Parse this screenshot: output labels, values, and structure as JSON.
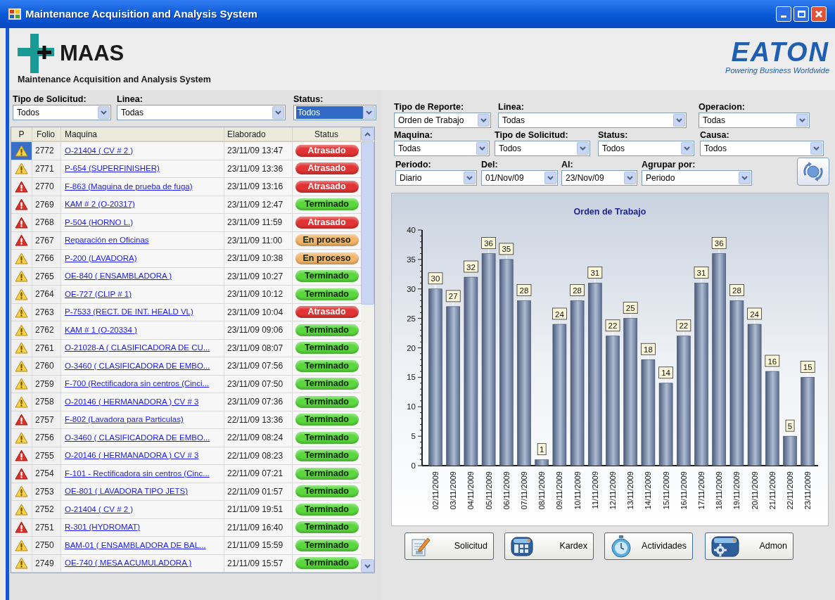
{
  "window": {
    "title": "Maintenance Acquisition and Analysis System"
  },
  "header": {
    "logo_text": "MAAS",
    "subtitle": "Maintenance Acquisition and Analysis System",
    "brand": "EATON",
    "tagline": "Powering Business Worldwide"
  },
  "list_filters": [
    {
      "label": "Tipo de Solicitud:",
      "value": "Todos",
      "focused": false
    },
    {
      "label": "Linea:",
      "value": "Todas",
      "focused": false
    },
    {
      "label": "Status:",
      "value": "Todos",
      "focused": true
    }
  ],
  "table": {
    "columns": [
      "P",
      "Folio",
      "Maquina",
      "Elaborado",
      "Status"
    ],
    "rows": [
      {
        "selected": true,
        "kind": "warning",
        "folio": "2772",
        "machine": "O-21404 ( CV # 2 )",
        "elaborado": "23/11/09 13:47",
        "status": {
          "text": "Atrasado",
          "color": "#e23434"
        }
      },
      {
        "selected": false,
        "kind": "warning",
        "folio": "2771",
        "machine": "P-654 (SUPERFINISHER)",
        "elaborado": "23/11/09 13:36",
        "status": {
          "text": "Atrasado",
          "color": "#e23434"
        }
      },
      {
        "selected": false,
        "kind": "critical",
        "folio": "2770",
        "machine": "F-863 (Maquina de prueba de fuga)",
        "elaborado": "23/11/09 13:16",
        "status": {
          "text": "Atrasado",
          "color": "#e23434"
        }
      },
      {
        "selected": false,
        "kind": "critical",
        "folio": "2769",
        "machine": "KAM # 2 (O-20317)",
        "elaborado": "23/11/09 12:47",
        "status": {
          "text": "Terminado",
          "color": "#5ad83e"
        }
      },
      {
        "selected": false,
        "kind": "critical",
        "folio": "2768",
        "machine": "P-504 (HORNO L.)",
        "elaborado": "23/11/09 11:59",
        "status": {
          "text": "Atrasado",
          "color": "#e23434"
        }
      },
      {
        "selected": false,
        "kind": "critical",
        "folio": "2767",
        "machine": "Reparación en Oficinas",
        "elaborado": "23/11/09 11:00",
        "status": {
          "text": "En proceso",
          "color": "#f3b56a"
        }
      },
      {
        "selected": false,
        "kind": "warning",
        "folio": "2766",
        "machine": "P-200 (LAVADORA)",
        "elaborado": "23/11/09 10:38",
        "status": {
          "text": "En proceso",
          "color": "#f3b56a"
        }
      },
      {
        "selected": false,
        "kind": "warning",
        "folio": "2765",
        "machine": "OE-840 ( ENSAMBLADORA )",
        "elaborado": "23/11/09 10:27",
        "status": {
          "text": "Terminado",
          "color": "#5ad83e"
        }
      },
      {
        "selected": false,
        "kind": "warning",
        "folio": "2764",
        "machine": "OE-727 (CLIP # 1)",
        "elaborado": "23/11/09 10:12",
        "status": {
          "text": "Terminado",
          "color": "#5ad83e"
        }
      },
      {
        "selected": false,
        "kind": "warning",
        "folio": "2763",
        "machine": "P-7533 (RECT. DE INT. HEALD VL)",
        "elaborado": "23/11/09 10:04",
        "status": {
          "text": "Atrasado",
          "color": "#e23434"
        }
      },
      {
        "selected": false,
        "kind": "warning",
        "folio": "2762",
        "machine": "KAM # 1 (O-20334 )",
        "elaborado": "23/11/09 09:06",
        "status": {
          "text": "Terminado",
          "color": "#5ad83e"
        }
      },
      {
        "selected": false,
        "kind": "warning",
        "folio": "2761",
        "machine": "O-21028-A ( CLASIFICADORA DE CU...",
        "elaborado": "23/11/09 08:07",
        "status": {
          "text": "Terminado",
          "color": "#5ad83e"
        }
      },
      {
        "selected": false,
        "kind": "warning",
        "folio": "2760",
        "machine": "O-3460 ( CLASIFICADORA DE EMBO...",
        "elaborado": "23/11/09 07:56",
        "status": {
          "text": "Terminado",
          "color": "#5ad83e"
        }
      },
      {
        "selected": false,
        "kind": "warning",
        "folio": "2759",
        "machine": "F-700 (Rectificadora sin centros (Cinci...",
        "elaborado": "23/11/09 07:50",
        "status": {
          "text": "Terminado",
          "color": "#5ad83e"
        }
      },
      {
        "selected": false,
        "kind": "warning",
        "folio": "2758",
        "machine": "O-20146 ( HERMANADORA ) CV # 3",
        "elaborado": "23/11/09 07:36",
        "status": {
          "text": "Terminado",
          "color": "#5ad83e"
        }
      },
      {
        "selected": false,
        "kind": "critical",
        "folio": "2757",
        "machine": "F-802 (Lavadora para Particulas)",
        "elaborado": "22/11/09 13:36",
        "status": {
          "text": "Terminado",
          "color": "#5ad83e"
        }
      },
      {
        "selected": false,
        "kind": "warning",
        "folio": "2756",
        "machine": "O-3460 ( CLASIFICADORA DE EMBO...",
        "elaborado": "22/11/09 08:24",
        "status": {
          "text": "Terminado",
          "color": "#5ad83e"
        }
      },
      {
        "selected": false,
        "kind": "critical",
        "folio": "2755",
        "machine": "O-20146 ( HERMANADORA ) CV # 3",
        "elaborado": "22/11/09 08:23",
        "status": {
          "text": "Terminado",
          "color": "#5ad83e"
        }
      },
      {
        "selected": false,
        "kind": "critical",
        "folio": "2754",
        "machine": "F-101 - Rectificadora sin centros (Cinc...",
        "elaborado": "22/11/09 07:21",
        "status": {
          "text": "Terminado",
          "color": "#5ad83e"
        }
      },
      {
        "selected": false,
        "kind": "warning",
        "folio": "2753",
        "machine": "OE-801 ( LAVADORA TIPO JETS)",
        "elaborado": "22/11/09 01:57",
        "status": {
          "text": "Terminado",
          "color": "#5ad83e"
        }
      },
      {
        "selected": false,
        "kind": "warning",
        "folio": "2752",
        "machine": "O-21404 ( CV # 2 )",
        "elaborado": "21/11/09 19:51",
        "status": {
          "text": "Terminado",
          "color": "#5ad83e"
        }
      },
      {
        "selected": false,
        "kind": "critical",
        "folio": "2751",
        "machine": "R-301 (HYDROMAT)",
        "elaborado": "21/11/09 16:40",
        "status": {
          "text": "Terminado",
          "color": "#5ad83e"
        }
      },
      {
        "selected": false,
        "kind": "warning",
        "folio": "2750",
        "machine": "BAM-01 ( ENSAMBLADORA DE BAL...",
        "elaborado": "21/11/09 15:59",
        "status": {
          "text": "Terminado",
          "color": "#5ad83e"
        }
      },
      {
        "selected": false,
        "kind": "warning",
        "folio": "2749",
        "machine": "OE-740 ( MESA ACUMULADORA )",
        "elaborado": "21/11/09 15:57",
        "status": {
          "text": "Terminado",
          "color": "#5ad83e"
        }
      }
    ]
  },
  "report_filters": [
    [
      {
        "label": "Tipo de Reporte:",
        "value": "Orden de Trabajo"
      },
      {
        "label": "Linea:",
        "value": "Todas"
      },
      {
        "label": "Operacion:",
        "value": "Todas"
      }
    ],
    [
      {
        "label": "Maquina:",
        "value": "Todas"
      },
      {
        "label": "Tipo de Solicitud:",
        "value": "Todos"
      },
      {
        "label": "Status:",
        "value": "Todos"
      },
      {
        "label": "Causa:",
        "value": "Todos"
      }
    ],
    [
      {
        "label": "Periodo:",
        "value": "Diario"
      },
      {
        "label": "Del:",
        "value": "01/Nov/09"
      },
      {
        "label": "Al:",
        "value": "23/Nov/09"
      },
      {
        "label": "Agrupar por:",
        "value": "Periodo"
      }
    ]
  ],
  "chart_data": {
    "type": "bar",
    "title": "Orden de Trabajo",
    "categories": [
      "02/11/2009",
      "03/11/2009",
      "04/11/2009",
      "05/11/2009",
      "06/11/2009",
      "07/11/2009",
      "08/11/2009",
      "09/11/2009",
      "10/11/2009",
      "11/11/2009",
      "12/11/2009",
      "13/11/2009",
      "14/11/2009",
      "15/11/2009",
      "16/11/2009",
      "17/11/2009",
      "18/11/2009",
      "19/11/2009",
      "20/11/2009",
      "21/11/2009",
      "22/11/2009",
      "23/11/2009"
    ],
    "values": [
      30,
      27,
      32,
      36,
      35,
      28,
      1,
      24,
      28,
      31,
      22,
      25,
      18,
      14,
      22,
      31,
      36,
      28,
      24,
      16,
      5,
      15
    ],
    "ylim": [
      0,
      40
    ],
    "yticks": [
      0,
      5,
      10,
      15,
      20,
      25,
      30,
      35,
      40
    ],
    "data_labels": true
  },
  "buttons": [
    {
      "label": "Solicitud",
      "kind": "solicitud"
    },
    {
      "label": "Kardex",
      "kind": "kardex"
    },
    {
      "label": "Actividades",
      "kind": "actividades"
    },
    {
      "label": "Admon",
      "kind": "admon"
    }
  ]
}
